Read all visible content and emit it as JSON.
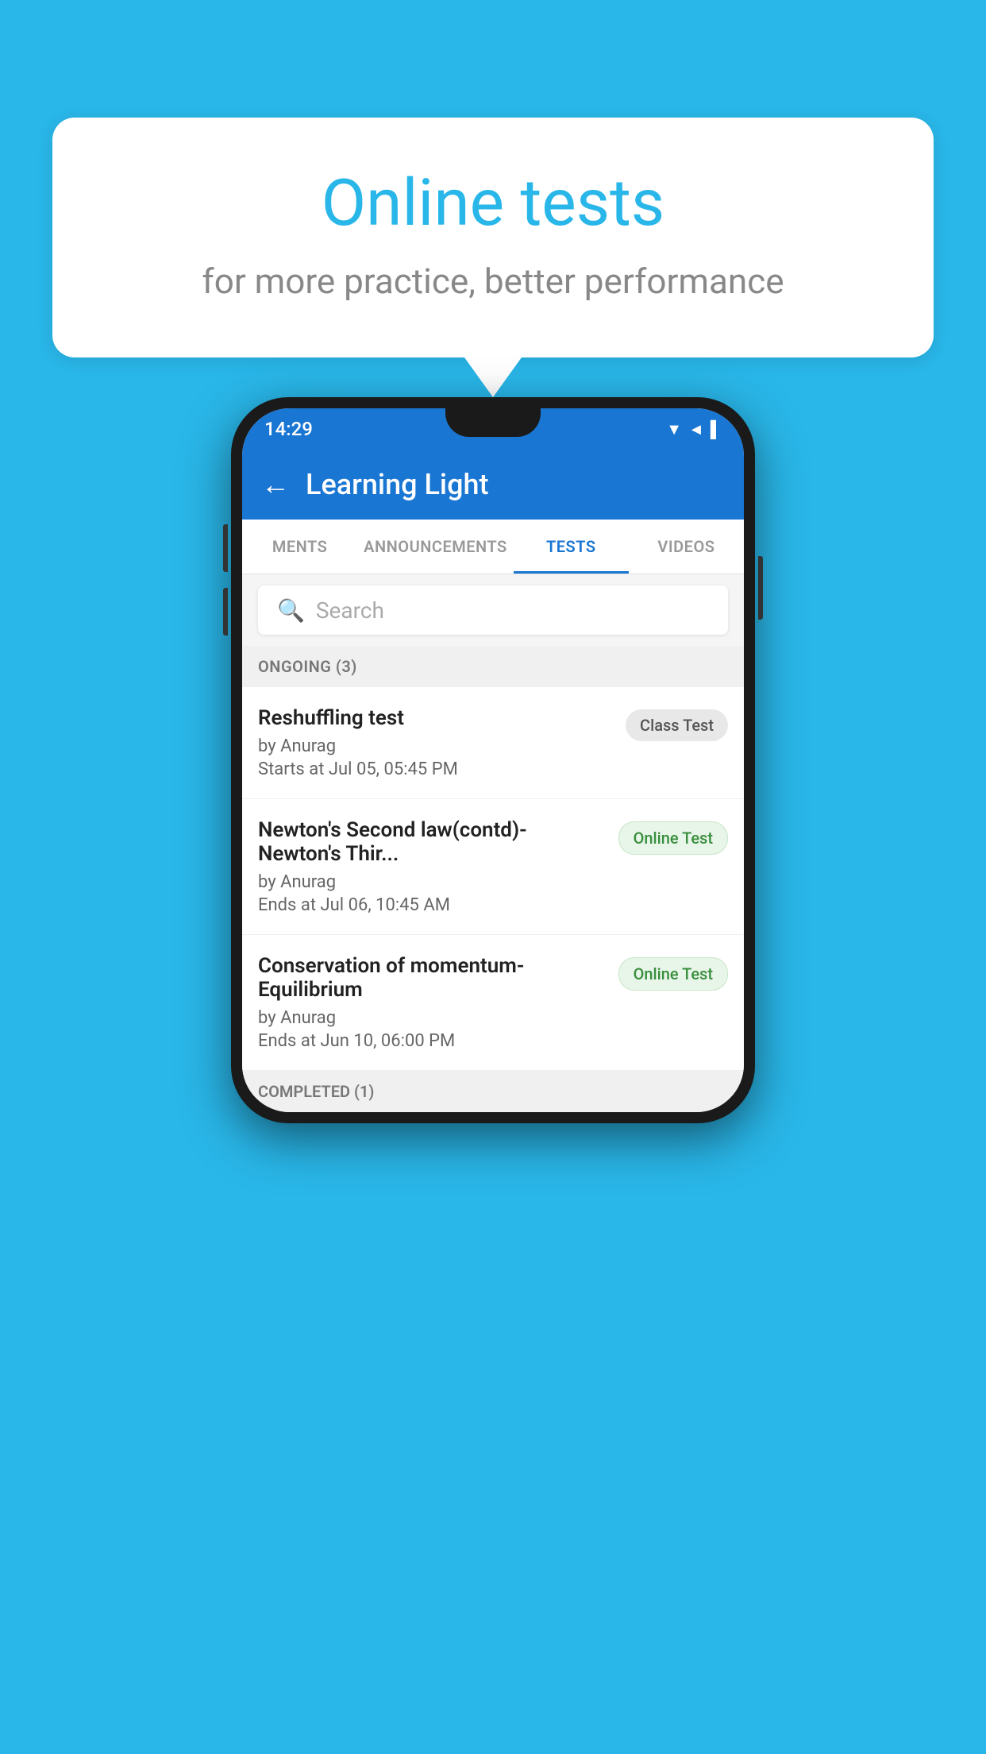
{
  "background_color": "#29B6E8",
  "speech_bubble": {
    "title": "Online tests",
    "subtitle": "for more practice, better performance"
  },
  "phone": {
    "status_bar": {
      "time": "14:29",
      "icons": "▼◄▌"
    },
    "app_bar": {
      "title": "Learning Light",
      "back_label": "←"
    },
    "tabs": [
      {
        "label": "MENTS",
        "active": false
      },
      {
        "label": "ANNOUNCEMENTS",
        "active": false
      },
      {
        "label": "TESTS",
        "active": true
      },
      {
        "label": "VIDEOS",
        "active": false
      }
    ],
    "search": {
      "placeholder": "Search"
    },
    "ongoing_section": {
      "label": "ONGOING (3)"
    },
    "tests": [
      {
        "name": "Reshuffling test",
        "author": "by Anurag",
        "time_label": "Starts at",
        "time": "Jul 05, 05:45 PM",
        "badge": "Class Test",
        "badge_type": "class"
      },
      {
        "name": "Newton's Second law(contd)-Newton's Thir...",
        "author": "by Anurag",
        "time_label": "Ends at",
        "time": "Jul 06, 10:45 AM",
        "badge": "Online Test",
        "badge_type": "online"
      },
      {
        "name": "Conservation of momentum-Equilibrium",
        "author": "by Anurag",
        "time_label": "Ends at",
        "time": "Jun 10, 06:00 PM",
        "badge": "Online Test",
        "badge_type": "online"
      }
    ],
    "completed_section": {
      "label": "COMPLETED (1)"
    }
  }
}
